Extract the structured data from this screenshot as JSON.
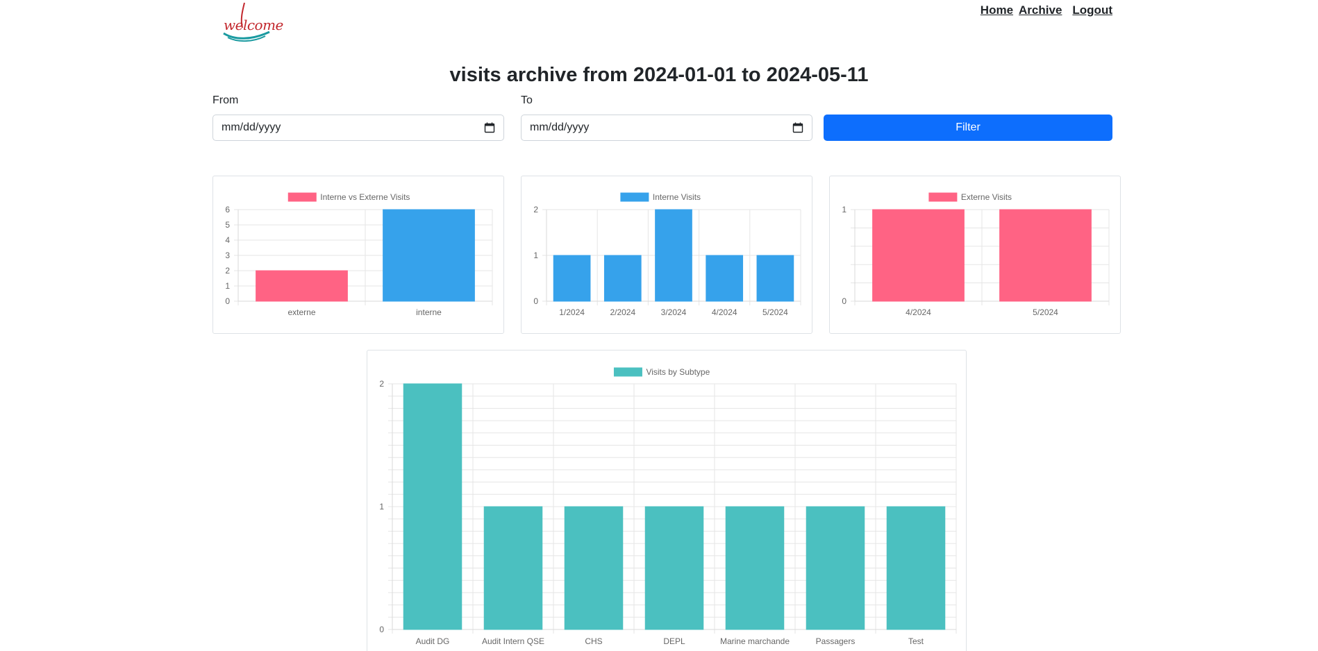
{
  "header": {
    "logo_text": "welcome",
    "nav": [
      {
        "label": "Home"
      },
      {
        "label": "Archive"
      },
      {
        "label": "Logout"
      }
    ]
  },
  "page_title": "visits archive from 2024-01-01 to 2024-05-11",
  "filter": {
    "from_label": "From",
    "to_label": "To",
    "from_placeholder": "mm/dd/yyyy",
    "to_placeholder": "mm/dd/yyyy",
    "button_label": "Filter"
  },
  "colors": {
    "pink": "#ff6384",
    "blue": "#36a2eb",
    "teal": "#4bc0c0",
    "primary": "#0d6efd"
  },
  "chart_data": [
    {
      "type": "bar",
      "legend": "Interne vs Externe Visits",
      "color": "#ff6384",
      "categories": [
        "externe",
        "interne"
      ],
      "values": [
        2,
        6
      ],
      "bar_colors": [
        "#ff6384",
        "#36a2eb"
      ],
      "yticks": [
        0,
        1,
        2,
        3,
        4,
        5,
        6
      ],
      "ylim": [
        0,
        6
      ]
    },
    {
      "type": "bar",
      "legend": "Interne Visits",
      "color": "#36a2eb",
      "categories": [
        "1/2024",
        "2/2024",
        "3/2024",
        "4/2024",
        "5/2024"
      ],
      "values": [
        1,
        1,
        2,
        1,
        1
      ],
      "yticks": [
        0,
        1,
        2
      ],
      "ylim": [
        0,
        2
      ]
    },
    {
      "type": "bar",
      "legend": "Externe Visits",
      "color": "#ff6384",
      "categories": [
        "4/2024",
        "5/2024"
      ],
      "values": [
        1,
        1
      ],
      "yticks": [
        0,
        1
      ],
      "ylim": [
        0,
        1
      ]
    },
    {
      "type": "bar",
      "legend": "Visits by Subtype",
      "color": "#4bc0c0",
      "categories": [
        "Audit DG",
        "Audit Intern QSE",
        "CHS",
        "DEPL",
        "Marine marchande",
        "Passagers",
        "Test"
      ],
      "values": [
        2,
        1,
        1,
        1,
        1,
        1,
        1
      ],
      "yticks": [
        0,
        1,
        2
      ],
      "ylim": [
        0,
        2
      ]
    }
  ]
}
